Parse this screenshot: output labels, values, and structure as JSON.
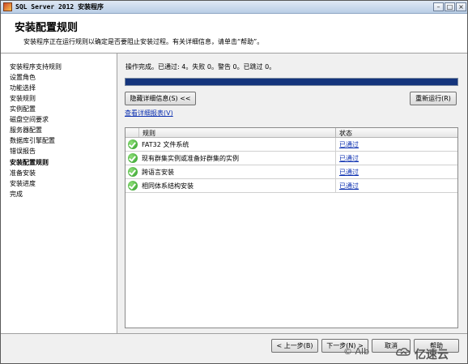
{
  "window": {
    "title": "SQL Server 2012 安装程序",
    "min_glyph": "–",
    "max_glyph": "□",
    "close_glyph": "×"
  },
  "header": {
    "title": "安装配置规则",
    "description": "安装程序正在运行规则以确定是否要阻止安装过程。有关详细信息，请单击“帮助”。"
  },
  "sidebar": {
    "items": [
      {
        "label": "安装程序支持规则"
      },
      {
        "label": "设置角色"
      },
      {
        "label": "功能选择"
      },
      {
        "label": "安装规则"
      },
      {
        "label": "实例配置"
      },
      {
        "label": "磁盘空间要求"
      },
      {
        "label": "服务器配置"
      },
      {
        "label": "数据库引擎配置"
      },
      {
        "label": "错误报告"
      },
      {
        "label": "安装配置规则"
      },
      {
        "label": "准备安装"
      },
      {
        "label": "安装进度"
      },
      {
        "label": "完成"
      }
    ],
    "active_index": 9
  },
  "main": {
    "status_text": "操作完成。已通过: 4。失败 0。警告 0。已跳过 0。",
    "progress_fraction": 1.0,
    "hide_details_label": "隐藏详细信息(S) <<",
    "rerun_label": "重新运行(R)",
    "view_report_link": "查看详细报表(V)",
    "table": {
      "columns": [
        "规则",
        "状态"
      ],
      "rows": [
        {
          "rule": "FAT32 文件系统",
          "status": "已通过"
        },
        {
          "rule": "现有群集实例或准备好群集的实例",
          "status": "已通过"
        },
        {
          "rule": "跨语言安装",
          "status": "已通过"
        },
        {
          "rule": "相同体系结构安装",
          "status": "已通过"
        }
      ]
    }
  },
  "footer": {
    "back_label": "< 上一步(B)",
    "next_label": "下一步(N) >",
    "cancel_label": "取消",
    "help_label": "帮助"
  },
  "watermark": {
    "left_text": "© Alb",
    "brand_text": "亿速云"
  },
  "colors": {
    "progress_fill": "#14347c",
    "link": "#0b2fb0",
    "pass_icon": "#2a9a23"
  }
}
